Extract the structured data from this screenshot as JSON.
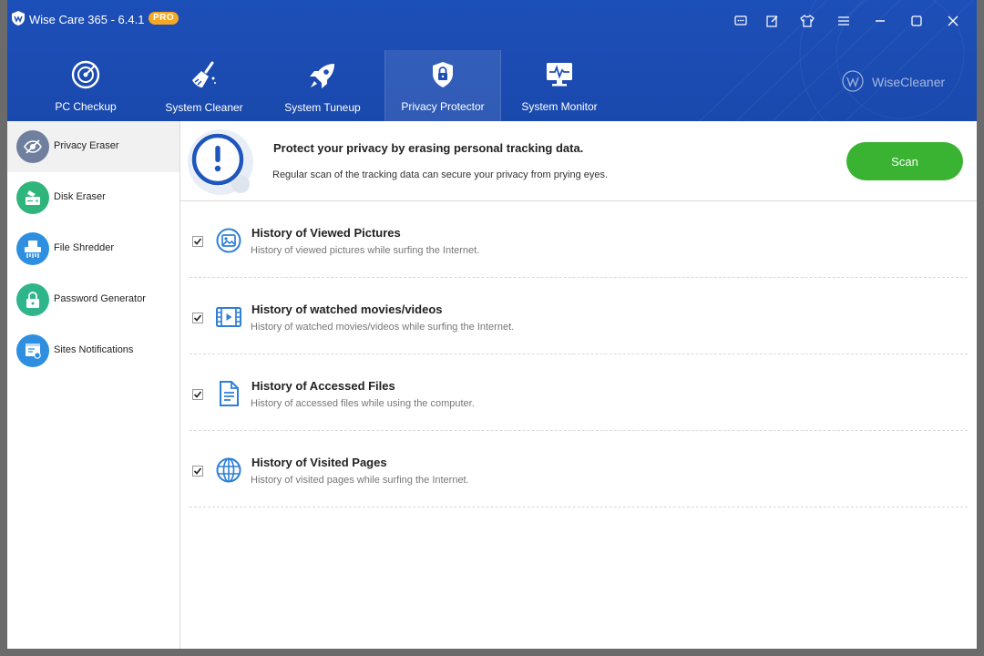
{
  "window": {
    "title": "Wise Care 365 - 6.4.1",
    "badge": "PRO",
    "brand": "WiseCleaner"
  },
  "nav": {
    "tabs": [
      {
        "label": "PC Checkup",
        "icon": "radar-icon"
      },
      {
        "label": "System Cleaner",
        "icon": "broom-icon"
      },
      {
        "label": "System Tuneup",
        "icon": "rocket-icon"
      },
      {
        "label": "Privacy Protector",
        "icon": "lock-shield-icon",
        "active": true
      },
      {
        "label": "System Monitor",
        "icon": "monitor-pulse-icon"
      }
    ]
  },
  "sidebar": {
    "items": [
      {
        "label": "Privacy Eraser",
        "icon": "eye-slash-icon",
        "color": "#6f7f9d",
        "active": true
      },
      {
        "label": "Disk Eraser",
        "icon": "disk-eraser-icon",
        "color": "#2fb57c"
      },
      {
        "label": "File Shredder",
        "icon": "shredder-icon",
        "color": "#2e8fe0"
      },
      {
        "label": "Password Generator",
        "icon": "padlock-icon",
        "color": "#2fb58c"
      },
      {
        "label": "Sites Notifications",
        "icon": "notification-icon",
        "color": "#2e8fe0"
      }
    ]
  },
  "header": {
    "title": "Protect your privacy by erasing personal tracking data.",
    "subtitle": "Regular scan of the tracking data can secure your privacy from prying eyes.",
    "scan_label": "Scan"
  },
  "items": [
    {
      "title": "History of Viewed Pictures",
      "desc": "History of viewed pictures while surfing the Internet.",
      "checked": true,
      "icon": "picture-icon"
    },
    {
      "title": "History of watched movies/videos",
      "desc": "History of watched movies/videos while surfing the Internet.",
      "checked": true,
      "icon": "film-icon"
    },
    {
      "title": "History of Accessed Files",
      "desc": "History of accessed files while using the computer.",
      "checked": true,
      "icon": "document-icon"
    },
    {
      "title": "History of Visited Pages",
      "desc": "History of visited pages while surfing the Internet.",
      "checked": true,
      "icon": "globe-icon"
    }
  ],
  "colors": {
    "header_blue": "#1d4fb8",
    "accent_green": "#3ab232",
    "item_icon_blue": "#2e7fd6"
  }
}
